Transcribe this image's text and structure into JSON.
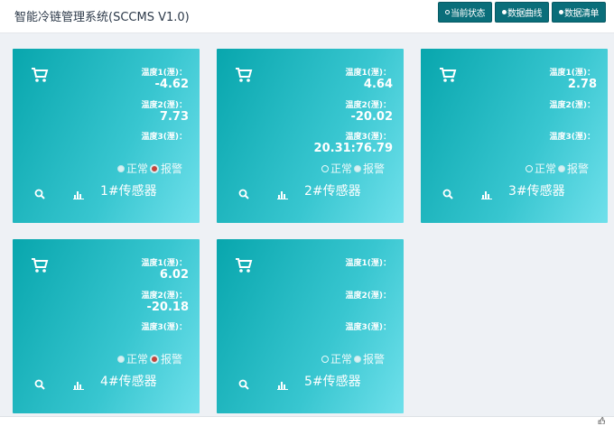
{
  "header": {
    "title": "智能冷链管理系统(SCCMS V1.0)",
    "nav": [
      "当前状态",
      "数据曲线",
      "数据清单"
    ],
    "active_index": 0
  },
  "labels": {
    "temp1": "温度1(溼)：",
    "temp2": "温度2(溼)：",
    "temp3": "温度3(溼)：",
    "normal": "正常",
    "alarm": "报警"
  },
  "sensors": [
    {
      "name": "1#传感器",
      "temp1": "-4.62",
      "temp2": "7.73",
      "temp3": "",
      "status": "alarm"
    },
    {
      "name": "2#传感器",
      "temp1": "4.64",
      "temp2": "-20.02",
      "temp3": "20.31:76.79",
      "status": "none"
    },
    {
      "name": "3#传感器",
      "temp1": "2.78",
      "temp2": "",
      "temp3": "",
      "status": "none"
    },
    {
      "name": "4#传感器",
      "temp1": "6.02",
      "temp2": "-20.18",
      "temp3": "",
      "status": "alarm"
    },
    {
      "name": "5#传感器",
      "temp1": "",
      "temp2": "",
      "temp3": "",
      "status": "none"
    }
  ],
  "colors": {
    "card_start": "#08a6ad",
    "card_end": "#6fe0eb",
    "nav_bg": "#0a6e7a",
    "alarm": "#c2453c"
  },
  "icons": [
    "cart-icon",
    "search-icon",
    "bar-chart-icon"
  ]
}
